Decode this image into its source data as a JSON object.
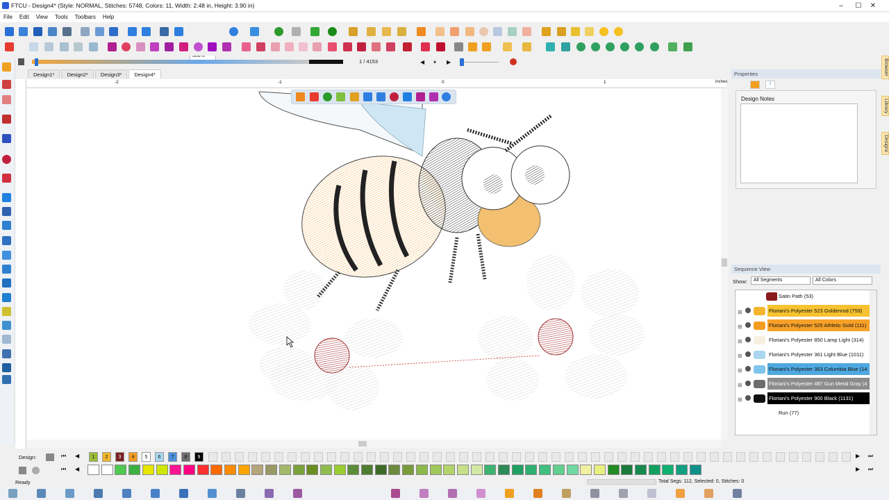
{
  "window": {
    "title": "FTCU - Design4* (Style: NORMAL, Stitches: 5748, Colors: 11, Width: 2.48 in, Height: 3.90 in)",
    "minimize": "–",
    "maximize": "☐",
    "close": "✕"
  },
  "menu": [
    "File",
    "Edit",
    "View",
    "Tools",
    "Toolbars",
    "Help"
  ],
  "toolbar": {
    "zoom": "366%"
  },
  "playback": {
    "stitch_position": "1 / 4153",
    "progress_fraction": 0.89
  },
  "tabs": [
    "Design1*",
    "Design2*",
    "Design3*",
    "Design4*"
  ],
  "active_tab": 3,
  "ruler": {
    "marks": [
      "-2",
      "-1",
      "0",
      "1"
    ],
    "unit": "inches"
  },
  "properties": {
    "header": "Properties",
    "notes_label": "Design Notes",
    "notes_value": ""
  },
  "sequence": {
    "header": "Sequence View",
    "show_label": "Show:",
    "segments_select": "All Segments",
    "colors_select": "All Colors",
    "rows": [
      {
        "label": "Satin Path (53)",
        "sub": true,
        "bg": "#ffffff",
        "fg": "#111111",
        "swatch": "#8b1a1a"
      },
      {
        "label": "Floriani's Polyester 523 Goldenrod (759)",
        "sub": false,
        "bg": "#f6c230",
        "fg": "#111111",
        "swatch": "#f2b52c"
      },
      {
        "label": "Floriani's Polyester 525 Athletic Gold (111)",
        "sub": false,
        "bg": "#f7a128",
        "fg": "#111111",
        "swatch": "#f49c22"
      },
      {
        "label": "Floriani's Polyester 850 Lamp Light (314)",
        "sub": false,
        "bg": "#ffffff",
        "fg": "#111111",
        "swatch": "#f5f0e0"
      },
      {
        "label": "Floriani's Polyester 361 Light Blue (1011)",
        "sub": false,
        "bg": "#ffffff",
        "fg": "#111111",
        "swatch": "#a9d6ee"
      },
      {
        "label": "Floriani's Polyester 363 Columbia Blue (14",
        "sub": false,
        "bg": "#4fa8df",
        "fg": "#111111",
        "swatch": "#7fc4ea"
      },
      {
        "label": "Floriani's Polyester 487 Gun Metal Gray (4",
        "sub": false,
        "bg": "#8c8c8c",
        "fg": "#ffffff",
        "swatch": "#6d6d6d"
      },
      {
        "label": "Floriani's Polyester 900 Black (1131)",
        "sub": false,
        "bg": "#000000",
        "fg": "#ffffff",
        "swatch": "#111111"
      },
      {
        "label": "Run (77)",
        "sub": true,
        "bg": "#ffffff",
        "fg": "#111111",
        "swatch": "#ffffff"
      }
    ]
  },
  "side_tabs": [
    "Browser",
    "Library",
    "Designs"
  ],
  "design_bar": {
    "label": "Design:",
    "chips": [
      {
        "n": "1",
        "color": "#9bbb3a",
        "fg": "#111111"
      },
      {
        "n": "2",
        "color": "#f2b52c",
        "fg": "#111111"
      },
      {
        "n": "3",
        "color": "#7a2222",
        "fg": "#ffffff"
      },
      {
        "n": "4",
        "color": "#f49c22",
        "fg": "#111111"
      },
      {
        "n": "5",
        "color": "#ffffff",
        "fg": "#111111"
      },
      {
        "n": "6",
        "color": "#a9d6ee",
        "fg": "#111111"
      },
      {
        "n": "7",
        "color": "#4a90d9",
        "fg": "#111111"
      },
      {
        "n": "8",
        "color": "#6d6d6d",
        "fg": "#111111"
      },
      {
        "n": "9",
        "color": "#000000",
        "fg": "#ffffff"
      }
    ]
  },
  "palette_colors": [
    "#ffffff",
    "#ffffff",
    "#4ec94e",
    "#3cb043",
    "#e6e600",
    "#cfe600",
    "#ff1493",
    "#ff0080",
    "#ff3030",
    "#ff6a00",
    "#ff8c00",
    "#ffa500",
    "#b5a57a",
    "#999966",
    "#a3b86a",
    "#7aa23b",
    "#6b8e23",
    "#8fbc4f",
    "#9acd32",
    "#5b8c3a",
    "#4f7d2f",
    "#3d6b27",
    "#6e8b3d",
    "#789c3c",
    "#8db94c",
    "#a0c75a",
    "#b3d46a",
    "#c6e08a",
    "#d4e8a6",
    "#3cb371",
    "#2e8b57",
    "#20a060",
    "#30b070",
    "#40c080",
    "#60d090",
    "#70d8a0",
    "#f0f0a0",
    "#e8f080",
    "#228b22",
    "#1a7a3a",
    "#168a50",
    "#12a060",
    "#10b070",
    "#0fa080",
    "#0e9088"
  ],
  "status": {
    "left": "Ready",
    "right": "Total Segs: 112, Selected: 0, Stitches: 0"
  }
}
